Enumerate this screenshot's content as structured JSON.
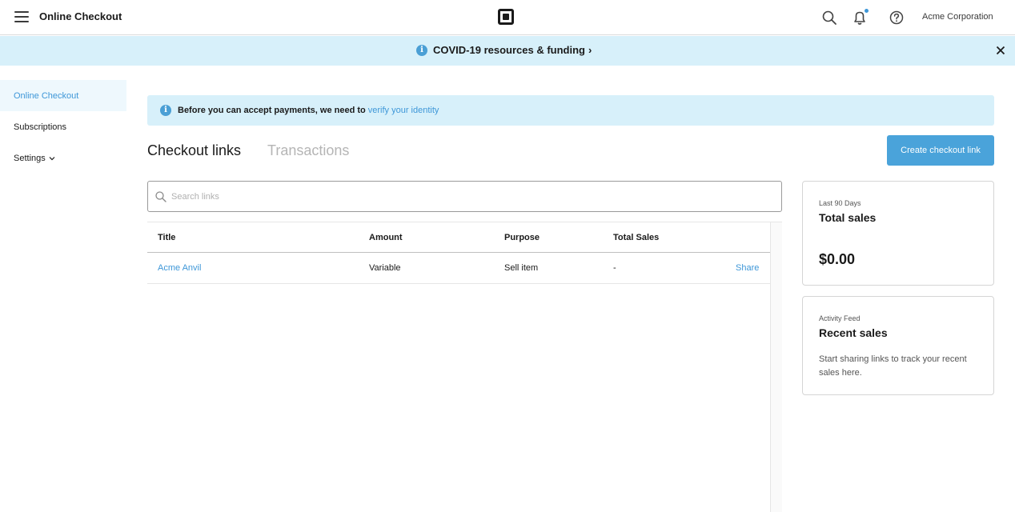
{
  "header": {
    "app_title": "Online Checkout",
    "account_name": "Acme Corporation"
  },
  "banner": {
    "text": "COVID-19 resources & funding",
    "chevron": "›"
  },
  "sidebar": {
    "items": [
      {
        "label": "Online Checkout",
        "active": true
      },
      {
        "label": "Subscriptions"
      },
      {
        "label": "Settings"
      }
    ]
  },
  "notice": {
    "text": "Before you can accept payments, we need to",
    "link": "verify your identity"
  },
  "tabs": {
    "active": "Checkout links",
    "inactive": "Transactions"
  },
  "actions": {
    "create_label": "Create checkout link"
  },
  "search": {
    "placeholder": "Search links"
  },
  "table": {
    "headers": [
      "Title",
      "Amount",
      "Purpose",
      "Total Sales"
    ],
    "rows": [
      {
        "title": "Acme Anvil",
        "amount": "Variable",
        "purpose": "Sell item",
        "total_sales": "-",
        "action": "Share"
      }
    ]
  },
  "cards": {
    "total": {
      "kicker": "Last 90 Days",
      "title": "Total sales",
      "amount": "$0.00"
    },
    "recent": {
      "kicker": "Activity Feed",
      "title": "Recent sales",
      "body": "Start sharing links to track your recent sales here."
    }
  },
  "colors": {
    "accent": "#3e97d8",
    "banner_bg": "#d7f0fa",
    "button_bg": "#4aa3da"
  },
  "icons": [
    "menu-icon",
    "square-logo-icon",
    "search-icon",
    "bell-icon",
    "help-icon",
    "info-icon",
    "close-icon",
    "chevron-down-icon"
  ]
}
